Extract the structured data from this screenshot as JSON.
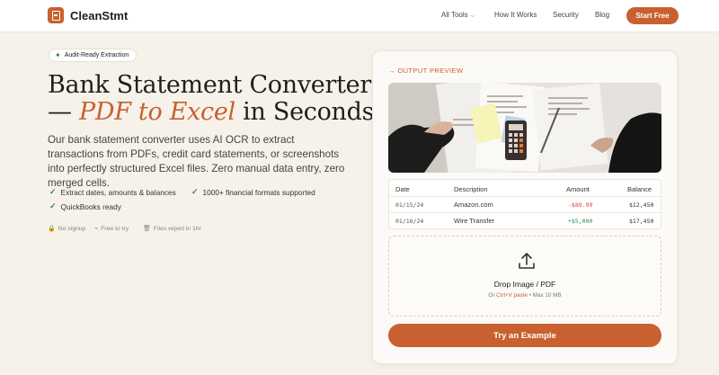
{
  "nav": {
    "brand": "CleanStmt",
    "links": [
      "All Tools",
      "How It Works",
      "Security",
      "Blog"
    ],
    "cta": "Start Free"
  },
  "hero": {
    "badge": "Audit-Ready Extraction",
    "title_line1": "Bank Statement Converter",
    "title_dash": "— ",
    "title_accent": "PDF to Excel",
    "title_end": " in Seconds",
    "lead": "Our bank statement converter uses AI OCR to extract transactions from PDFs, credit card statements, or screenshots into perfectly structured Excel files. Zero manual data entry, zero merged cells.",
    "features": [
      "Extract dates, amounts & balances",
      "1000+ financial formats supported",
      "QuickBooks ready"
    ],
    "mini": [
      "No signup",
      "Free to try",
      "Files wiped in 1hr"
    ]
  },
  "preview": {
    "label": "→ OUTPUT PREVIEW",
    "columns": [
      "Date",
      "Description",
      "Amount",
      "Balance"
    ],
    "rows": [
      [
        "01/15/24",
        "Amazon.com",
        "-$89.99",
        "$12,450"
      ],
      [
        "01/16/24",
        "Wire Transfer",
        "+$5,000",
        "$17,450"
      ]
    ]
  },
  "upload": {
    "title": "Drop Image / PDF",
    "sub_prefix": "Or ",
    "sub_highlight": "Ctrl+V paste",
    "sub_suffix": " • Max 10 MB"
  },
  "try_button": "Try an Example",
  "colors": {
    "accent": "#c8602f",
    "background": "#f6f2ea",
    "negative": "#d04a3a",
    "positive": "#2e8b57"
  }
}
